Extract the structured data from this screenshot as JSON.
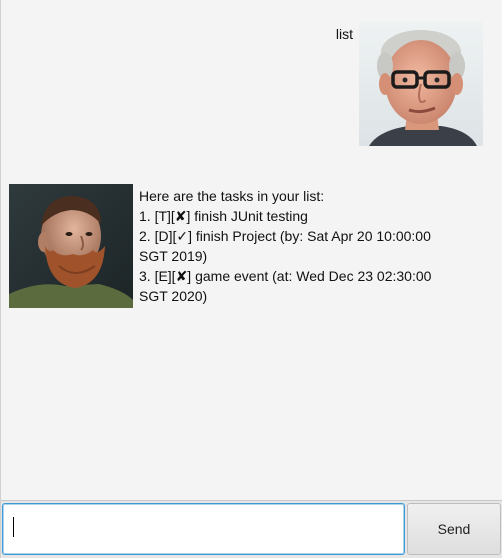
{
  "chat": {
    "user_message": {
      "text": "list",
      "avatar_icon": "user-photo-glasses-man"
    },
    "duke_message": {
      "avatar_icon": "duke-photo-bearded-man",
      "lines": [
        "Here are the tasks in your list:",
        "1. [T][✘] finish JUnit testing",
        "2. [D][✓] finish Project (by: Sat Apr 20 10:00:00",
        "SGT 2019)",
        "3. [E][✘] game event (at: Wed Dec 23 02:30:00",
        "SGT 2020)"
      ]
    }
  },
  "input": {
    "value": "",
    "placeholder": ""
  },
  "send_label": "Send",
  "colors": {
    "background": "#f4f4f4",
    "input_focus_border": "#3d9ad6"
  }
}
